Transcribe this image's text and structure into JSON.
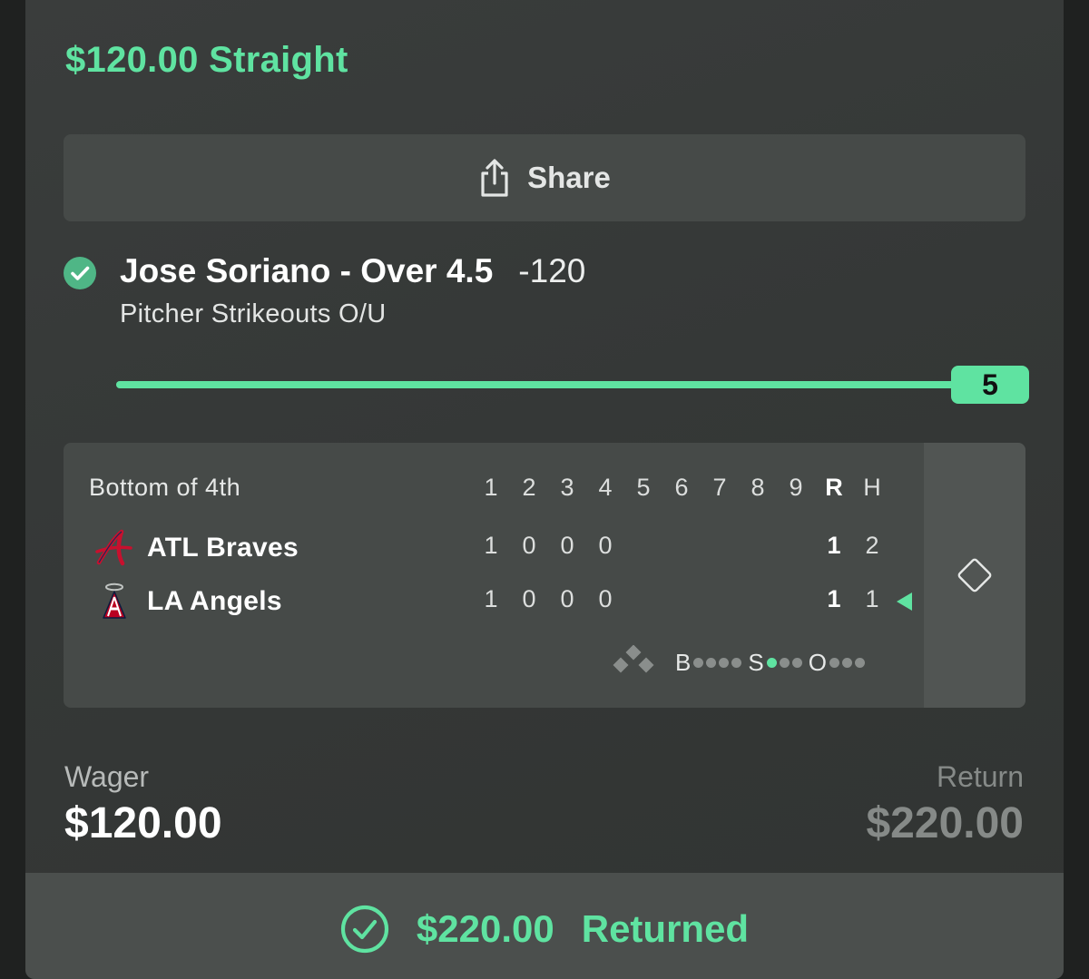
{
  "bet": {
    "title": "$120.00 Straight"
  },
  "share": {
    "label": "Share",
    "icon": "share-icon"
  },
  "selection": {
    "status_icon": "check-circle-icon",
    "name": "Jose Soriano - Over 4.5",
    "odds": "-120",
    "market": "Pitcher Strikeouts O/U",
    "progress": {
      "value": "5",
      "fraction": 1.0
    }
  },
  "scoreboard": {
    "status": "Bottom of 4th",
    "innings": [
      "1",
      "2",
      "3",
      "4",
      "5",
      "6",
      "7",
      "8",
      "9"
    ],
    "runs_header": "R",
    "hits_header": "H",
    "teams": [
      {
        "name": "ATL Braves",
        "logo": "braves-logo-icon",
        "innings": [
          "1",
          "0",
          "0",
          "0",
          "",
          "",
          "",
          "",
          ""
        ],
        "runs": "1",
        "hits": "2",
        "batting": false
      },
      {
        "name": "LA Angels",
        "logo": "angels-logo-icon",
        "innings": [
          "1",
          "0",
          "0",
          "0",
          "",
          "",
          "",
          "",
          ""
        ],
        "runs": "1",
        "hits": "1",
        "batting": true
      }
    ],
    "count": {
      "balls_label": "B",
      "strikes_label": "S",
      "outs_label": "O",
      "balls": 0,
      "strikes": 1,
      "outs": 0
    },
    "side_icon": "diamond-icon"
  },
  "wager": {
    "label": "Wager",
    "value": "$120.00"
  },
  "return": {
    "label": "Return",
    "value": "$220.00"
  },
  "footer": {
    "icon": "check-circle-icon",
    "amount": "$220.00",
    "status": "Returned"
  },
  "colors": {
    "accent": "#5fe3a1",
    "card_bg": "#353837",
    "panel_bg": "#464a48",
    "muted_text": "#868a88"
  }
}
